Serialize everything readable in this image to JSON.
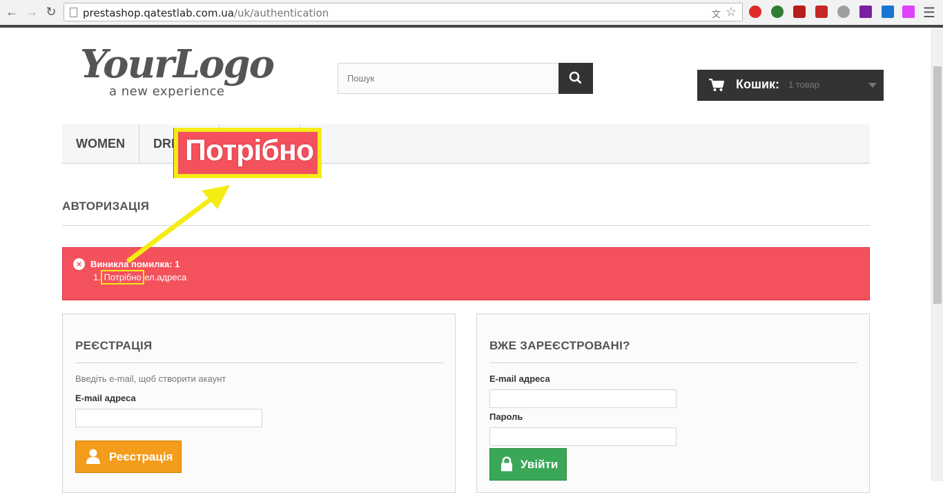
{
  "browser": {
    "url_host": "prestashop.qatestlab.com.ua",
    "url_path": "/uk/authentication"
  },
  "colors": {
    "alert_bg": "#f3515c",
    "highlight": "#f5ec16",
    "register_button": "#f49c1b",
    "login_button": "#3aa757",
    "dark": "#333333"
  },
  "header": {
    "logo_main": "YourLogo",
    "logo_sub": "a new experience",
    "search_placeholder": "Пошук",
    "cart_label": "Кошик:",
    "cart_qty": "1 товар"
  },
  "menu": {
    "items": [
      "WOMEN",
      "DRI"
    ]
  },
  "page": {
    "heading": "АВТОРИЗАЦІЯ"
  },
  "alert": {
    "title": "Виникла помилка: 1",
    "item_number": "1.",
    "item_highlight": "Потрібно",
    "item_rest": "ел.адреса"
  },
  "annotation": {
    "zoom_text": "Потрібно"
  },
  "register": {
    "title": "РЕЄСТРАЦІЯ",
    "hint": "Введіть e-mail, щоб створити акаунт",
    "email_label": "E-mail адреса",
    "button_label": "Реєстрація"
  },
  "login": {
    "title": "ВЖЕ ЗАРЕЄСТРОВАНІ?",
    "email_label": "E-mail адреса",
    "password_label": "Пароль",
    "button_label": "Увійти"
  }
}
